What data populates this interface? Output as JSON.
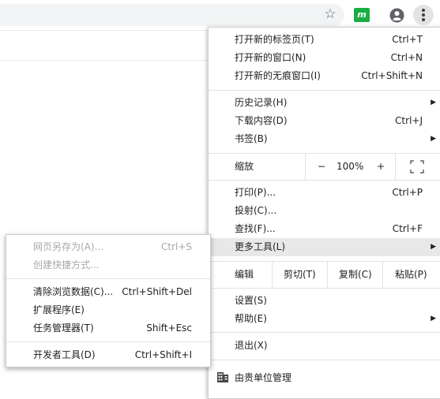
{
  "main_menu": {
    "new_tab": {
      "label": "打开新的标签页(T)",
      "shortcut": "Ctrl+T"
    },
    "new_window": {
      "label": "打开新的窗口(N)",
      "shortcut": "Ctrl+N"
    },
    "new_incognito": {
      "label": "打开新的无痕窗口(I)",
      "shortcut": "Ctrl+Shift+N"
    },
    "history": {
      "label": "历史记录(H)"
    },
    "downloads": {
      "label": "下载内容(D)",
      "shortcut": "Ctrl+J"
    },
    "bookmarks": {
      "label": "书签(B)"
    },
    "zoom": {
      "label": "缩放",
      "minus": "−",
      "value": "100%",
      "plus": "+"
    },
    "print": {
      "label": "打印(P)...",
      "shortcut": "Ctrl+P"
    },
    "cast": {
      "label": "投射(C)..."
    },
    "find": {
      "label": "查找(F)...",
      "shortcut": "Ctrl+F"
    },
    "more_tools": {
      "label": "更多工具(L)"
    },
    "edit": {
      "label": "编辑",
      "cut": "剪切(T)",
      "copy": "复制(C)",
      "paste": "粘贴(P)"
    },
    "settings": {
      "label": "设置(S)"
    },
    "help": {
      "label": "帮助(E)"
    },
    "exit": {
      "label": "退出(X)"
    },
    "managed": {
      "label": "由贵单位管理"
    }
  },
  "more_tools_menu": {
    "save_page": {
      "label": "网页另存为(A)...",
      "shortcut": "Ctrl+S"
    },
    "create_shortcut": {
      "label": "创建快捷方式..."
    },
    "clear_data": {
      "label": "清除浏览数据(C)...",
      "shortcut": "Ctrl+Shift+Del"
    },
    "extensions": {
      "label": "扩展程序(E)"
    },
    "task_manager": {
      "label": "任务管理器(T)",
      "shortcut": "Shift+Esc"
    },
    "dev_tools": {
      "label": "开发者工具(D)",
      "shortcut": "Ctrl+Shift+I"
    }
  },
  "icons": {
    "star": "star-icon",
    "extension": "extension-icon",
    "avatar": "account-icon",
    "menu": "more-vert-icon",
    "fullscreen": "fullscreen-icon",
    "building": "building-icon",
    "submenu_arrow": "chevron-right-icon"
  },
  "colors": {
    "highlight": "#e8e8e8",
    "extension_green": "#1aad43",
    "disabled_text": "#a8a8a8"
  }
}
